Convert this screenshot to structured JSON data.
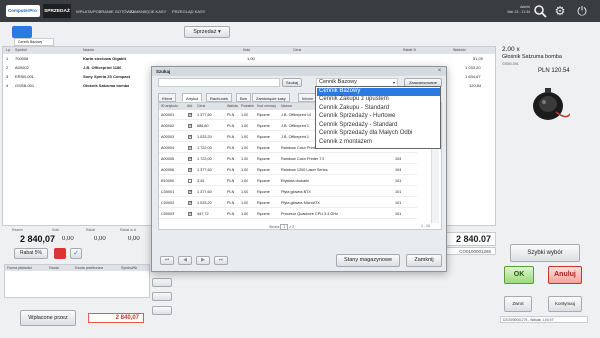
{
  "header": {
    "brand": "ComputerPro",
    "tabs": [
      "SPRZEDAŻ",
      "WPŁATA/POBRANIE GOTÓWKI",
      "ZAMKNIĘCIE KASY",
      "PRZEGLĄD KASY"
    ],
    "user_name": "Admin",
    "user_date": "Mar 23 - 11:34"
  },
  "left": {
    "doc_type": "Sprzedaż",
    "client_label": "Cennik Bazowy",
    "columns": [
      "Lp.",
      "Symbol",
      "Nazwa",
      "Ilość",
      "Cena",
      "Rabat %",
      "Wartość"
    ],
    "rows": [
      {
        "lp": "1",
        "symbol": "700008",
        "name": "Karta sieciowa Gigabit",
        "qty": "1,00",
        "price": "",
        "disc": "",
        "value": "51,00"
      },
      {
        "lp": "2",
        "symbol": "A00002",
        "name": "J.B. Officeprint 1186",
        "qty": "",
        "price": "",
        "disc": "",
        "value": "1 033,20"
      },
      {
        "lp": "3",
        "symbol": "ERSB-001",
        "name": "Sony Xperia Z3 Compact",
        "qty": "",
        "price": "",
        "disc": "",
        "value": "1 634,67"
      },
      {
        "lp": "4",
        "symbol": "GSSB-001",
        "name": "Głośnik Satzuma bomba",
        "qty": "",
        "price": "",
        "disc": "",
        "value": "120,54"
      }
    ],
    "totals_labels": [
      "Razem",
      "Ilość",
      "Rabat",
      "Rabat w zł"
    ],
    "totals_values": [
      "2 840,07",
      "0,00",
      "0,00",
      "0,00"
    ],
    "discount_btn": "Rabat 5%",
    "payment_cols": [
      "Forma płatności",
      "Kwota",
      "Kwota przeliczona",
      "Symbol/Nr"
    ],
    "prepay_btn": "Wpłacone przez",
    "pay_total": "2 840,07"
  },
  "dialog": {
    "title": "Szukaj",
    "search_btn": "Szukaj",
    "price_list": "Cennik Bazowy",
    "adv_btn": "Zaawansowane",
    "tabs": [
      "Klient",
      "Artykuł",
      "Rachunek",
      "Bon",
      "Zamknięcie kasy",
      "Inform"
    ],
    "columns": [
      "ID artykułu",
      "Akt.",
      "Cena",
      "Waluta",
      "Podatek",
      "Kod cenowy",
      "Nazwa",
      "Stan",
      "Jm"
    ],
    "rows": [
      {
        "id": "A00001",
        "chk": true,
        "price": "1 377,60",
        "cur": "PLN",
        "tax": "1.00",
        "code": "Ręczne",
        "name": "J.B. Officeprint 14",
        "stock": "",
        "u": ""
      },
      {
        "id": "A00002",
        "chk": true,
        "price": "686,80",
        "cur": "PLN",
        "tax": "1.00",
        "code": "Ręczne",
        "name": "J.B. Officeprint 1",
        "stock": "",
        "u": ""
      },
      {
        "id": "A00003",
        "chk": true,
        "price": "1 033,20",
        "cur": "PLN",
        "tax": "1.00",
        "code": "Ręczne",
        "name": "J.B. Officeprint 1",
        "stock": "",
        "u": ""
      },
      {
        "id": "A00004",
        "chk": true,
        "price": "1 722,00",
        "cur": "PLN",
        "tax": "1.00",
        "code": "Ręczne",
        "name": "Rainbow Color Printer 5.0",
        "stock": "104",
        "u": ""
      },
      {
        "id": "A00005",
        "chk": true,
        "price": "1 722,00",
        "cur": "PLN",
        "tax": "1.00",
        "code": "Ręczne",
        "name": "Rainbow Color Printer 7.5",
        "stock": "104",
        "u": ""
      },
      {
        "id": "A00006",
        "chk": true,
        "price": "1 377,60",
        "cur": "PLN",
        "tax": "1.00",
        "code": "Ręczne",
        "name": "Rainbow 1200 Laser Series",
        "stock": "104",
        "u": ""
      },
      {
        "id": "B10000",
        "chk": false,
        "price": "3,44",
        "cur": "PLN",
        "tax": "1.00",
        "code": "Ręczne",
        "name": "Etykieta drukarki",
        "stock": "101",
        "u": ""
      },
      {
        "id": "C00001",
        "chk": true,
        "price": "1 377,60",
        "cur": "PLN",
        "tax": "1.00",
        "code": "Ręczne",
        "name": "Płyta główna BTX",
        "stock": "101",
        "u": ""
      },
      {
        "id": "C00002",
        "chk": true,
        "price": "1 033,20",
        "cur": "PLN",
        "tax": "1.00",
        "code": "Ręczne",
        "name": "Płyta główna MicroATX",
        "stock": "101",
        "u": ""
      },
      {
        "id": "C00003",
        "chk": true,
        "price": "447,72",
        "cur": "PLN",
        "tax": "1.00",
        "code": "Ręczne",
        "name": "Procesor Quadcore CPU 3.4 GHz",
        "stock": "101",
        "u": ""
      }
    ],
    "page_label": "Strona",
    "page_num": "1",
    "page_of": "z 2",
    "range": "1 - 10",
    "stock_btn": "Stany magazynowe",
    "close_btn": "Zamknij",
    "price_options": [
      "Cennik Bazowy",
      "Cennik Zakupu z upustem",
      "Cennik Zakupu - Standard",
      "Cennik Sprzedaży - Hurtowe",
      "Cennik Sprzedaży - Standard",
      "Cennik Sprzedaży dla Małych Odbi",
      "Cennik z montażem"
    ]
  },
  "right": {
    "qty": "2.00 x",
    "product": "Głośnik Satzuma bomba",
    "product_code": "GSSB-001",
    "price": "PLN 120.54",
    "total": "2 840.07",
    "doc_number": "CO0100001265",
    "quick_btn": "Szybki wybór",
    "ok_btn": "OK",
    "cancel_btn": "Anuluj",
    "return_btn": "Zwrot",
    "cont_btn": "Kontynuuj",
    "footer": "D2/20/00001775 - Waluta: 1,00 ET"
  }
}
